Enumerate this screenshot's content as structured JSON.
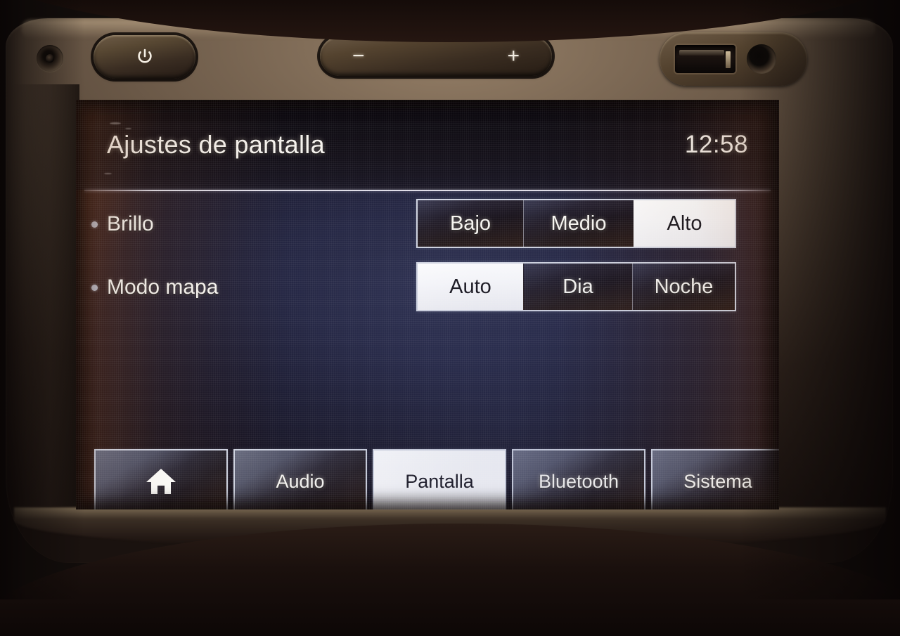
{
  "device": {
    "hardware": {
      "sensor_name": "ir-sensor",
      "power_button_label": "⏻",
      "volume_down_label": "−",
      "volume_up_label": "+",
      "usb_port_name": "usb-port",
      "aux_jack_name": "aux-jack"
    }
  },
  "screen": {
    "header": {
      "title": "Ajustes de pantalla",
      "clock": "12:58"
    },
    "settings": [
      {
        "label": "Brillo",
        "options": [
          {
            "label": "Bajo",
            "selected": false
          },
          {
            "label": "Medio",
            "selected": false
          },
          {
            "label": "Alto",
            "selected": true
          }
        ]
      },
      {
        "label": "Modo mapa",
        "options": [
          {
            "label": "Auto",
            "selected": true
          },
          {
            "label": "Dia",
            "selected": false
          },
          {
            "label": "Noche",
            "selected": false
          }
        ]
      }
    ],
    "tabs": [
      {
        "label": "",
        "icon": "home-icon",
        "selected": false
      },
      {
        "label": "Audio",
        "icon": "",
        "selected": false
      },
      {
        "label": "Pantalla",
        "icon": "",
        "selected": true
      },
      {
        "label": "Bluetooth",
        "icon": "",
        "selected": false
      },
      {
        "label": "Sistema",
        "icon": "",
        "selected": false
      }
    ]
  },
  "colors": {
    "screen_background": "#1d1d33",
    "selected_background": "#ffffff",
    "selected_text": "#17151c",
    "unselected_text": "#f7f5f1",
    "border": "#cfd3e0",
    "bezel": "#6b5947"
  }
}
